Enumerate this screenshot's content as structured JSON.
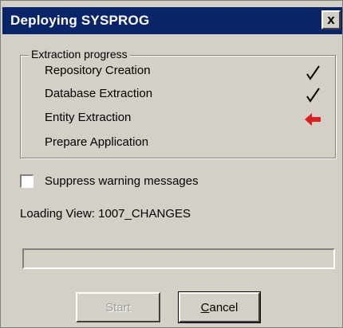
{
  "window": {
    "title": "Deploying SYSPROG",
    "close_glyph": "x"
  },
  "extraction": {
    "group_label": "Extraction progress",
    "steps": [
      {
        "label": "Repository Creation",
        "status": "done",
        "icon": "check-icon"
      },
      {
        "label": "Database Extraction",
        "status": "done",
        "icon": "check-icon"
      },
      {
        "label": "Entity Extraction",
        "status": "current",
        "icon": "arrow-left-icon"
      },
      {
        "label": "Prepare Application",
        "status": "pending",
        "icon": ""
      }
    ],
    "current_arrow_color": "#e02020"
  },
  "options": {
    "suppress_warnings_label": "Suppress warning messages",
    "suppress_warnings_checked": false
  },
  "status": {
    "loading_label": "Loading View:",
    "loading_value": "1007_CHANGES"
  },
  "progress": {
    "fraction": 0
  },
  "buttons": {
    "start_label": "Start",
    "start_enabled": false,
    "cancel_first": "C",
    "cancel_rest": "ancel"
  },
  "colors": {
    "titlebar": "#0a246a",
    "face": "#d4d0c8"
  }
}
